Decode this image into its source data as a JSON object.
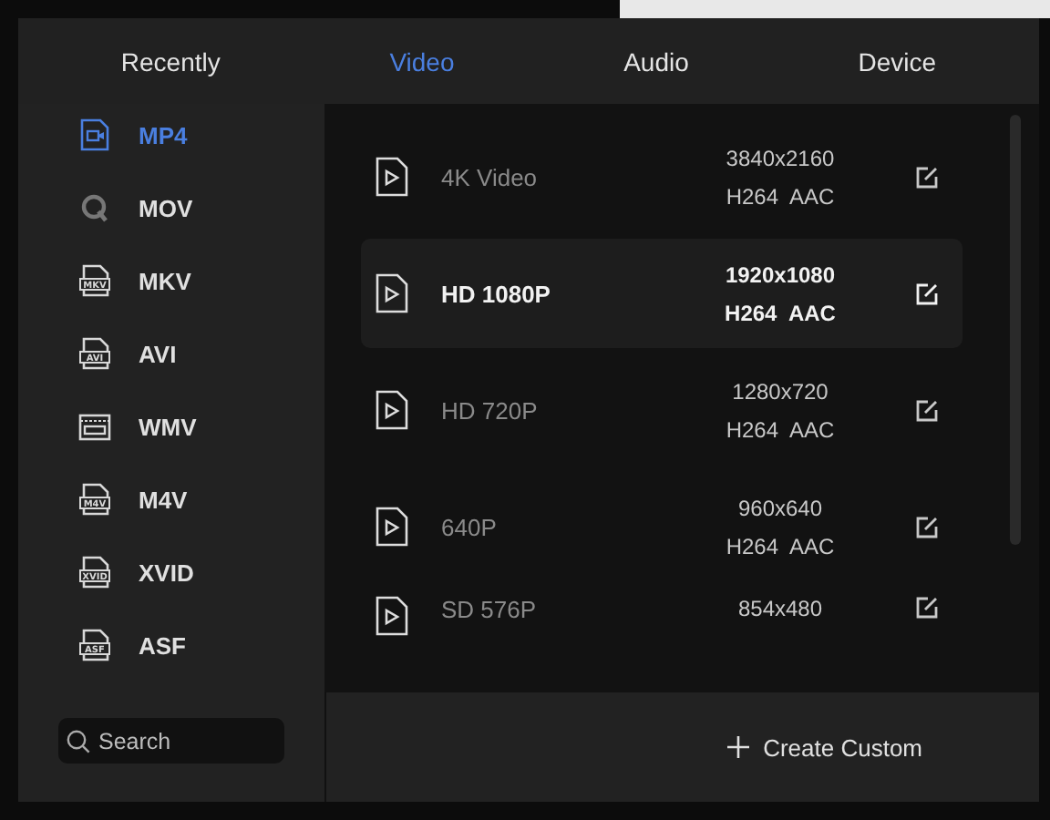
{
  "tabs": [
    {
      "label": "Recently",
      "selected": false
    },
    {
      "label": "Video",
      "selected": true
    },
    {
      "label": "Audio",
      "selected": false
    },
    {
      "label": "Device",
      "selected": false
    }
  ],
  "formats": [
    {
      "name": "MP4",
      "kind": "camera",
      "selected": true
    },
    {
      "name": "MOV",
      "kind": "quicktime",
      "selected": false
    },
    {
      "name": "MKV",
      "kind": "labeled",
      "icon_label": "MKV",
      "selected": false
    },
    {
      "name": "AVI",
      "kind": "labeled",
      "icon_label": "AVI",
      "selected": false
    },
    {
      "name": "WMV",
      "kind": "film",
      "selected": false
    },
    {
      "name": "M4V",
      "kind": "labeled",
      "icon_label": "M4V",
      "selected": false
    },
    {
      "name": "XVID",
      "kind": "labeled",
      "icon_label": "XVID",
      "selected": false
    },
    {
      "name": "ASF",
      "kind": "labeled",
      "icon_label": "ASF",
      "selected": false
    }
  ],
  "search": {
    "placeholder": "Search"
  },
  "presets": [
    {
      "name": "4K Video",
      "resolution": "3840x2160",
      "codec": "H264  AAC",
      "selected": false
    },
    {
      "name": "HD 1080P",
      "resolution": "1920x1080",
      "codec": "H264  AAC",
      "selected": true
    },
    {
      "name": "HD 720P",
      "resolution": "1280x720",
      "codec": "H264  AAC",
      "selected": false
    },
    {
      "name": "640P",
      "resolution": "960x640",
      "codec": "H264  AAC",
      "selected": false
    },
    {
      "name": "SD 576P",
      "resolution": "854x480",
      "selected": false
    }
  ],
  "create_button": {
    "label": "Create Custom"
  }
}
